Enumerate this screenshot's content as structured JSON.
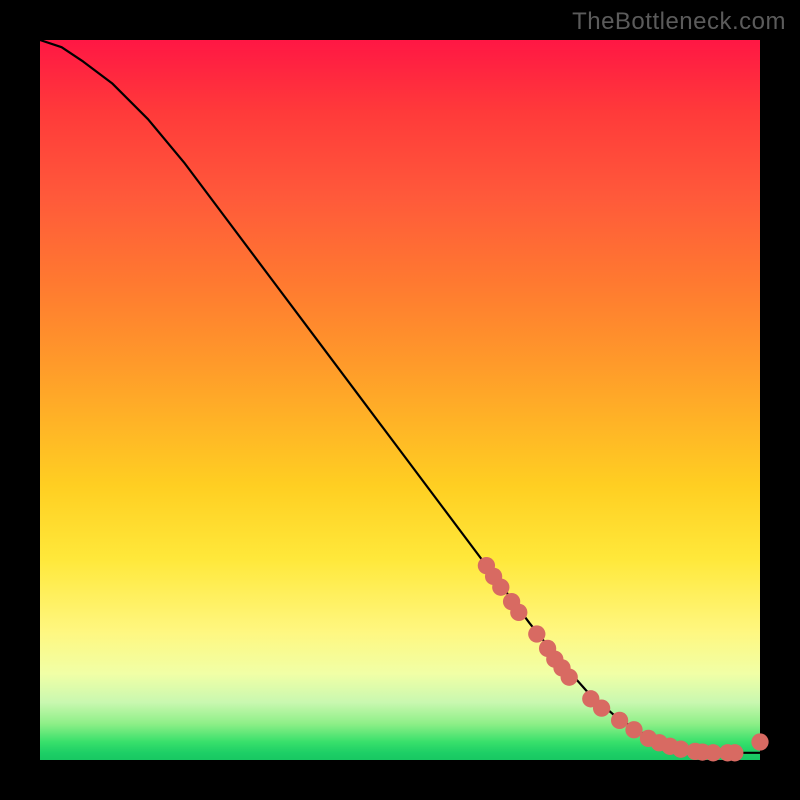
{
  "watermark": "TheBottleneck.com",
  "chart_data": {
    "type": "line",
    "title": "",
    "xlabel": "",
    "ylabel": "",
    "xlim": [
      0,
      100
    ],
    "ylim": [
      0,
      100
    ],
    "grid": false,
    "legend": false,
    "series": [
      {
        "name": "curve",
        "x": [
          0,
          3,
          6,
          10,
          15,
          20,
          26,
          32,
          38,
          44,
          50,
          56,
          62,
          68,
          72,
          76,
          80,
          84,
          88,
          92,
          96,
          100
        ],
        "values": [
          100,
          99,
          97,
          94,
          89,
          83,
          75,
          67,
          59,
          51,
          43,
          35,
          27,
          19,
          14,
          9.5,
          6,
          3.5,
          2.0,
          1.2,
          1.0,
          1.0
        ]
      }
    ],
    "markers": {
      "name": "highlight-points",
      "color": "#d86a62",
      "radius_norm": 0.012,
      "x": [
        62,
        63,
        64,
        65.5,
        66.5,
        69,
        70.5,
        71.5,
        72.5,
        73.5,
        76.5,
        78,
        80.5,
        82.5,
        84.5,
        86,
        87.5,
        89,
        91,
        92,
        93.5,
        95.5,
        96.5,
        100
      ],
      "values": [
        27,
        25.5,
        24,
        22,
        20.5,
        17.5,
        15.5,
        14,
        12.8,
        11.5,
        8.5,
        7.2,
        5.5,
        4.2,
        3.0,
        2.4,
        1.9,
        1.5,
        1.2,
        1.1,
        1.0,
        1.0,
        1.0,
        2.5
      ]
    }
  }
}
